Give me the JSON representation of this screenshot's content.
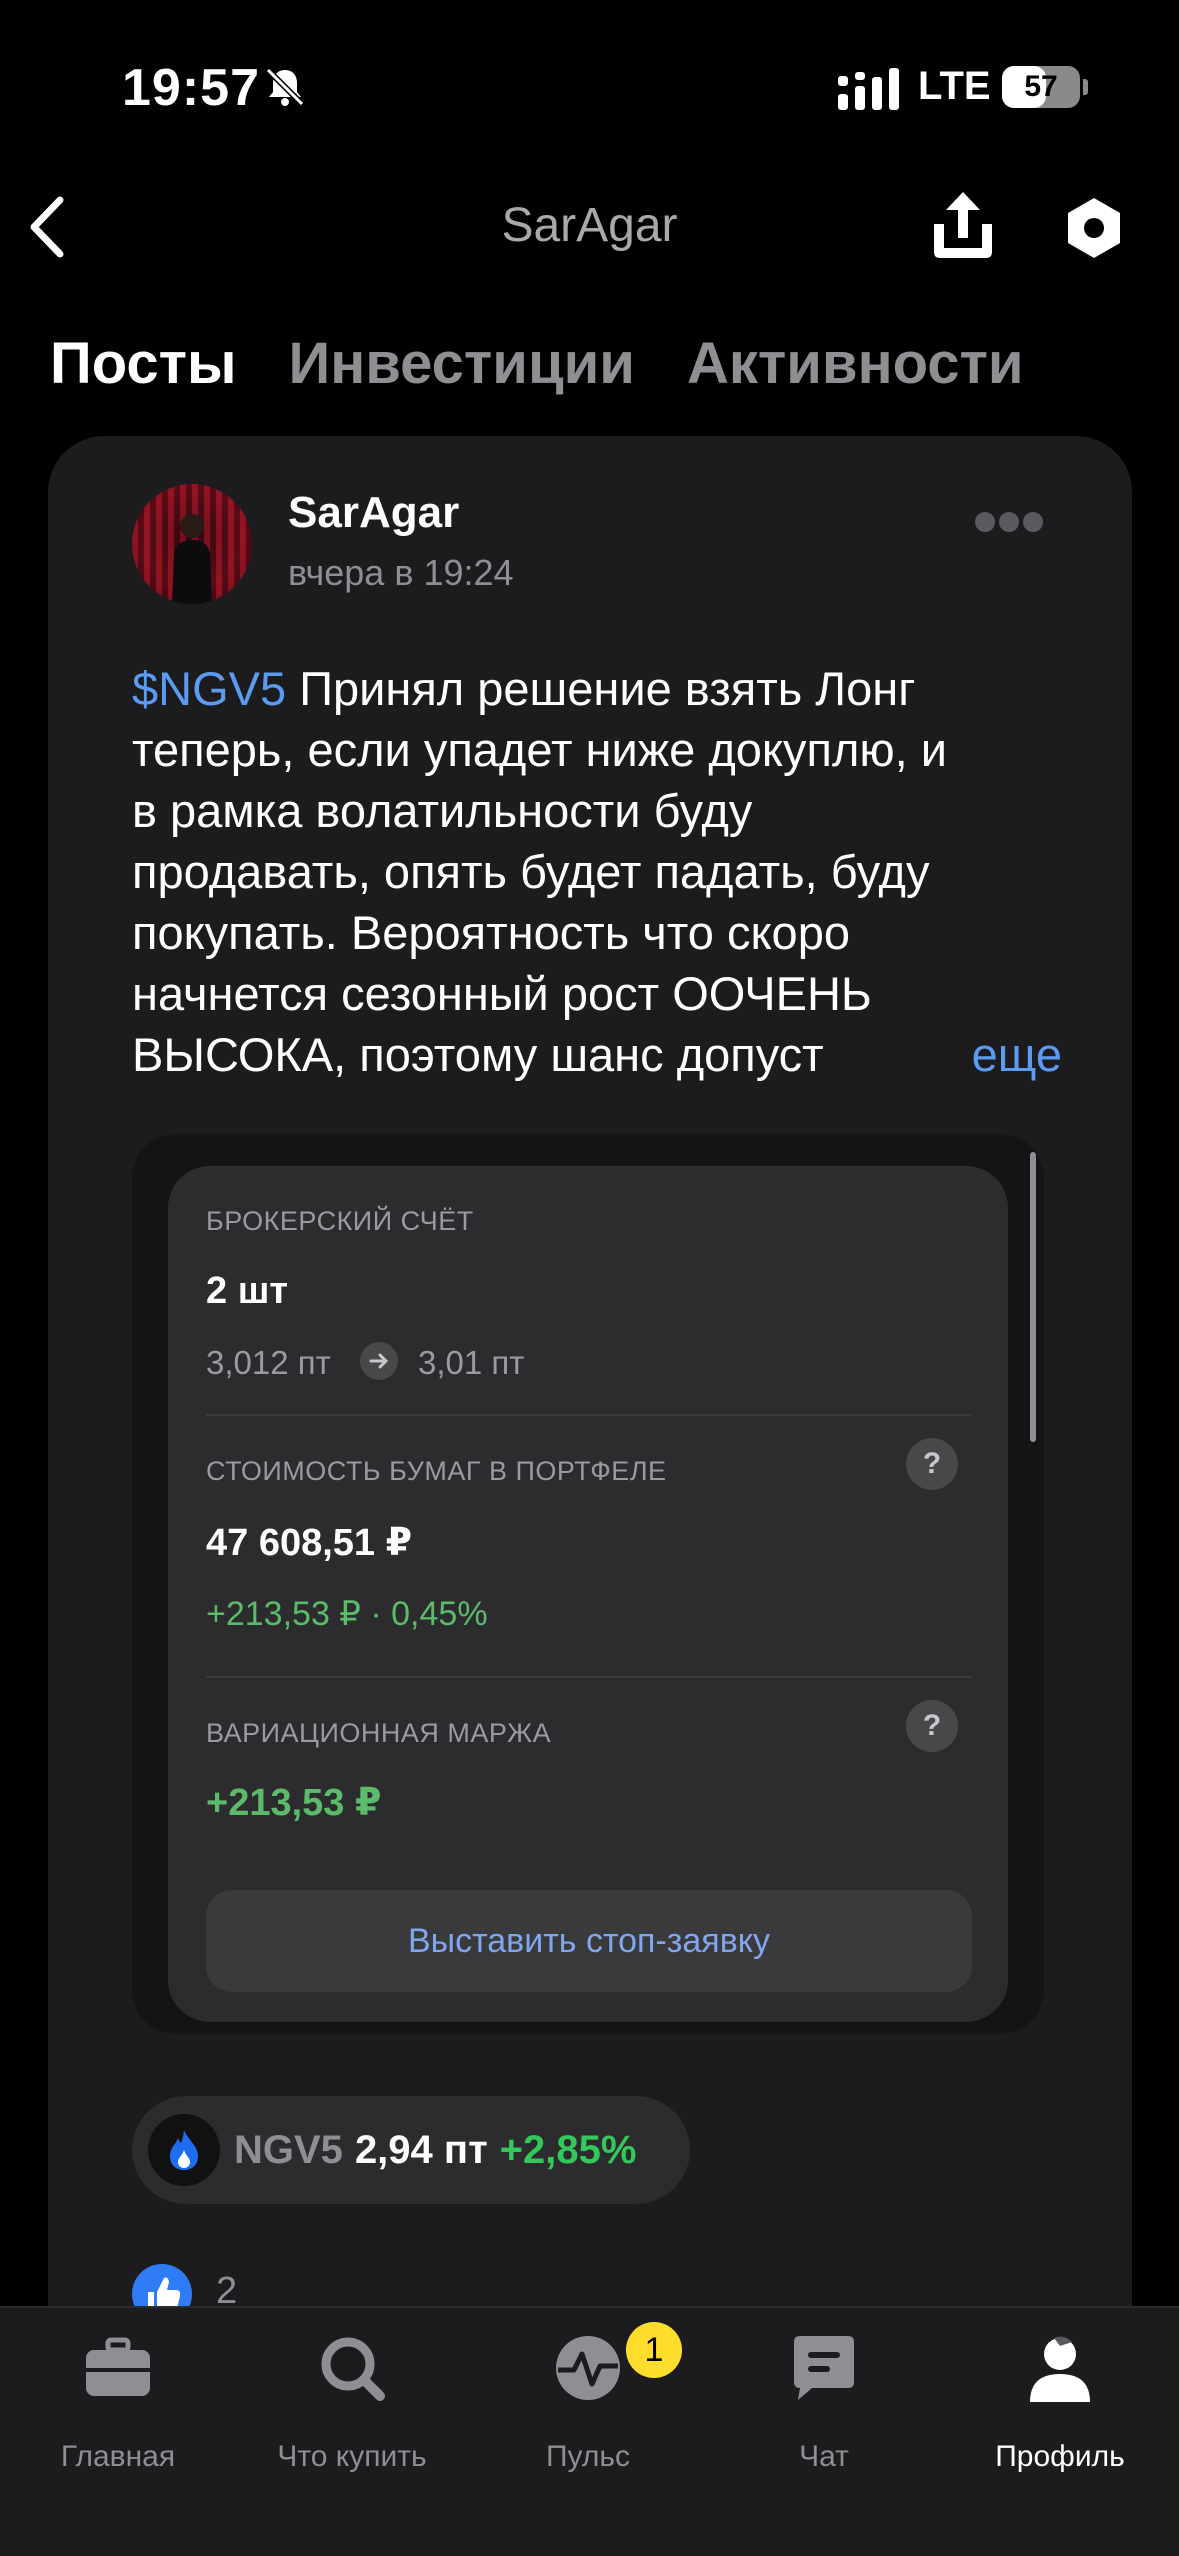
{
  "status_bar": {
    "time": "19:57",
    "network": "LTE",
    "battery": "57",
    "battery_level": 0.57
  },
  "nav": {
    "title": "SarAgar"
  },
  "tabs": [
    {
      "label": "Посты",
      "active": true
    },
    {
      "label": "Инвестиции",
      "active": false
    },
    {
      "label": "Активности",
      "active": false
    }
  ],
  "post": {
    "author": "SarAgar",
    "time": "вчера в 19:24",
    "ticker_tag": "$NGV5",
    "lines": [
      "Принял решение взять Лонг",
      "теперь, если упадет ниже докуплю, и",
      "в рамка волатильности буду",
      "продавать, опять будет падать, буду",
      "покупать. Вероятность что скоро",
      "начнется сезонный рост ООЧЕНЬ",
      "ВЫСОКА, поэтому шанс допуст"
    ],
    "more_label": "еще",
    "embed": {
      "section1_label": "БРОКЕРСКИЙ СЧЁТ",
      "quantity": "2 шт",
      "price_from": "3,012 пт",
      "price_to": "3,01 пт",
      "section2_label": "СТОИМОСТЬ БУМАГ В ПОРТФЕЛЕ",
      "portfolio_value": "47 608,51 ₽",
      "portfolio_change": "+213,53 ₽ · 0,45%",
      "section3_label": "ВАРИАЦИОННАЯ МАРЖА",
      "margin_value": "+213,53 ₽",
      "help_symbol": "?",
      "stop_button": "Выставить стоп-заявку"
    },
    "ticker_chip": {
      "ticker": "NGV5",
      "price": "2,94 пт",
      "change": "+2,85%",
      "icon": "flame-icon"
    },
    "likes": "2"
  },
  "tab_bar": {
    "items": [
      {
        "label": "Главная",
        "icon": "briefcase-icon"
      },
      {
        "label": "Что купить",
        "icon": "search-icon"
      },
      {
        "label": "Пульс",
        "icon": "pulse-icon",
        "badge": "1"
      },
      {
        "label": "Чат",
        "icon": "chat-icon"
      },
      {
        "label": "Профиль",
        "icon": "profile-icon",
        "active": true
      }
    ]
  },
  "colors": {
    "accent_blue": "#5b9cf2",
    "positive_green": "#34c759",
    "badge_yellow": "#ffdd2d",
    "card_bg": "#1c1c1e"
  }
}
